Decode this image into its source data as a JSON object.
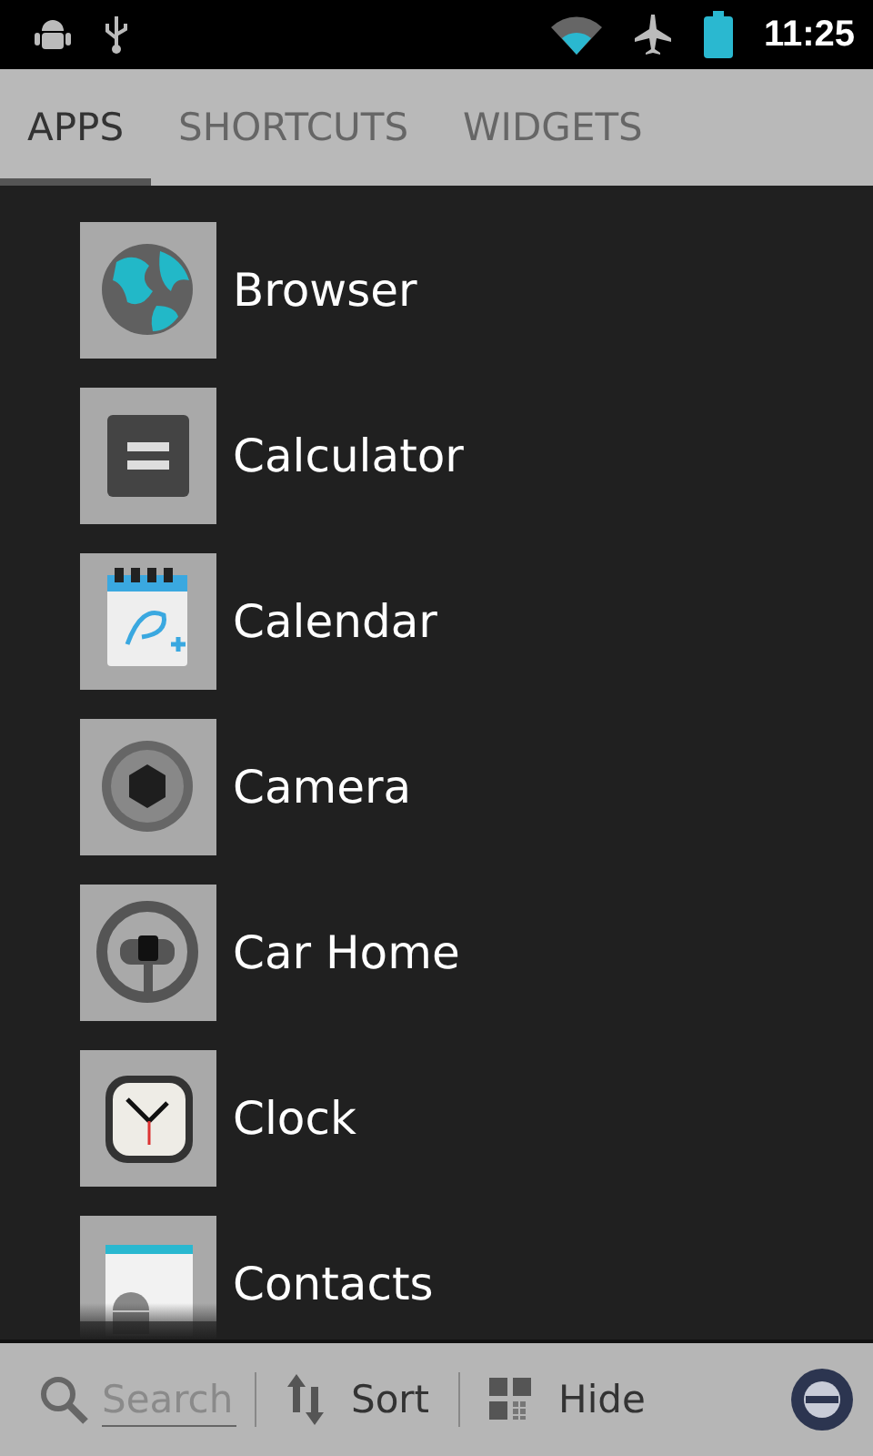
{
  "status_bar": {
    "time": "11:25"
  },
  "tabs": [
    {
      "label": "APPS",
      "selected": true
    },
    {
      "label": "SHORTCUTS",
      "selected": false
    },
    {
      "label": "WIDGETS",
      "selected": false
    }
  ],
  "apps": [
    {
      "name": "Browser",
      "kind": "browser"
    },
    {
      "name": "Calculator",
      "kind": "calculator"
    },
    {
      "name": "Calendar",
      "kind": "calendar"
    },
    {
      "name": "Camera",
      "kind": "camera"
    },
    {
      "name": "Car Home",
      "kind": "car"
    },
    {
      "name": "Clock",
      "kind": "clock"
    },
    {
      "name": "Contacts",
      "kind": "contacts"
    }
  ],
  "toolbar": {
    "search": {
      "placeholder": "Search"
    },
    "sort": "Sort",
    "hide": "Hide"
  }
}
